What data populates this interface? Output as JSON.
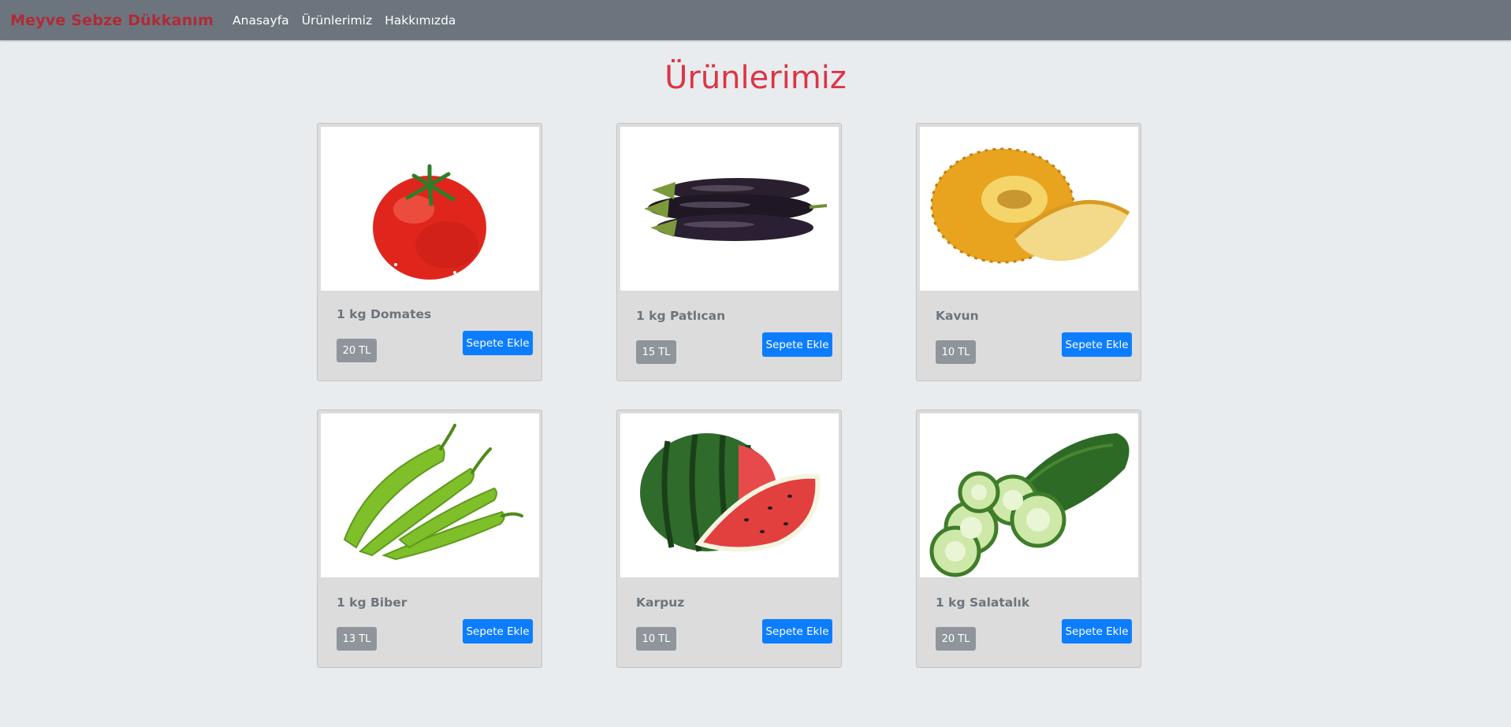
{
  "navbar": {
    "brand": "Meyve Sebze Dükkanım",
    "links": [
      "Anasayfa",
      "Ürünlerimiz",
      "Hakkımızda"
    ]
  },
  "page": {
    "title": "Ürünlerimiz"
  },
  "products": [
    {
      "name": "1 kg Domates",
      "price": "20 TL",
      "button": "Sepete Ekle",
      "image": "tomato-image"
    },
    {
      "name": "1 kg Patlıcan",
      "price": "15 TL",
      "button": "Sepete Ekle",
      "image": "eggplant-image"
    },
    {
      "name": "Kavun",
      "price": "10 TL",
      "button": "Sepete Ekle",
      "image": "melon-image"
    },
    {
      "name": "1 kg Biber",
      "price": "13 TL",
      "button": "Sepete Ekle",
      "image": "pepper-image"
    },
    {
      "name": "Karpuz",
      "price": "10 TL",
      "button": "Sepete Ekle",
      "image": "watermelon-image"
    },
    {
      "name": "1 kg Salatalık",
      "price": "20 TL",
      "button": "Sepete Ekle",
      "image": "cucumber-image"
    }
  ],
  "colors": {
    "navbar": "#6c757d",
    "brand": "#b02a37",
    "title": "#dc3545",
    "button": "#0d7dff",
    "price_badge": "#8f959a"
  }
}
